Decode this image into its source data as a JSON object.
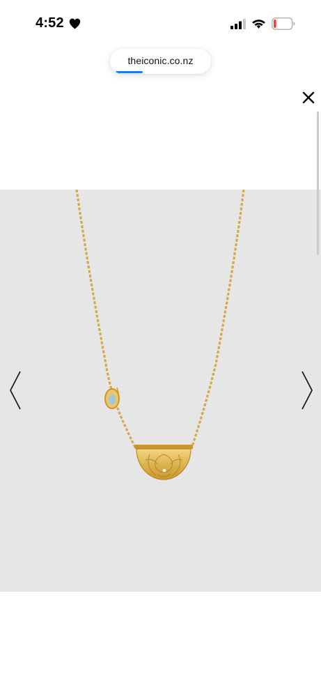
{
  "status_bar": {
    "time": "4:52",
    "icons": [
      "heart-icon",
      "cellular-signal-icon",
      "wifi-icon",
      "battery-icon"
    ],
    "battery_level": 0.15,
    "battery_color": "#ff3b30"
  },
  "browser": {
    "url": "theiconic.co.nz",
    "load_progress": 0.3,
    "progress_color": "#1a7cf0"
  },
  "controls": {
    "close_icon": "close-icon",
    "prev_icon": "chevron-left-icon",
    "next_icon": "chevron-right-icon"
  },
  "product_image": {
    "subject": "gold-necklace-half-moon-pendant",
    "background_color": "#e6e6e6",
    "gold_color": "#d8ad45"
  }
}
